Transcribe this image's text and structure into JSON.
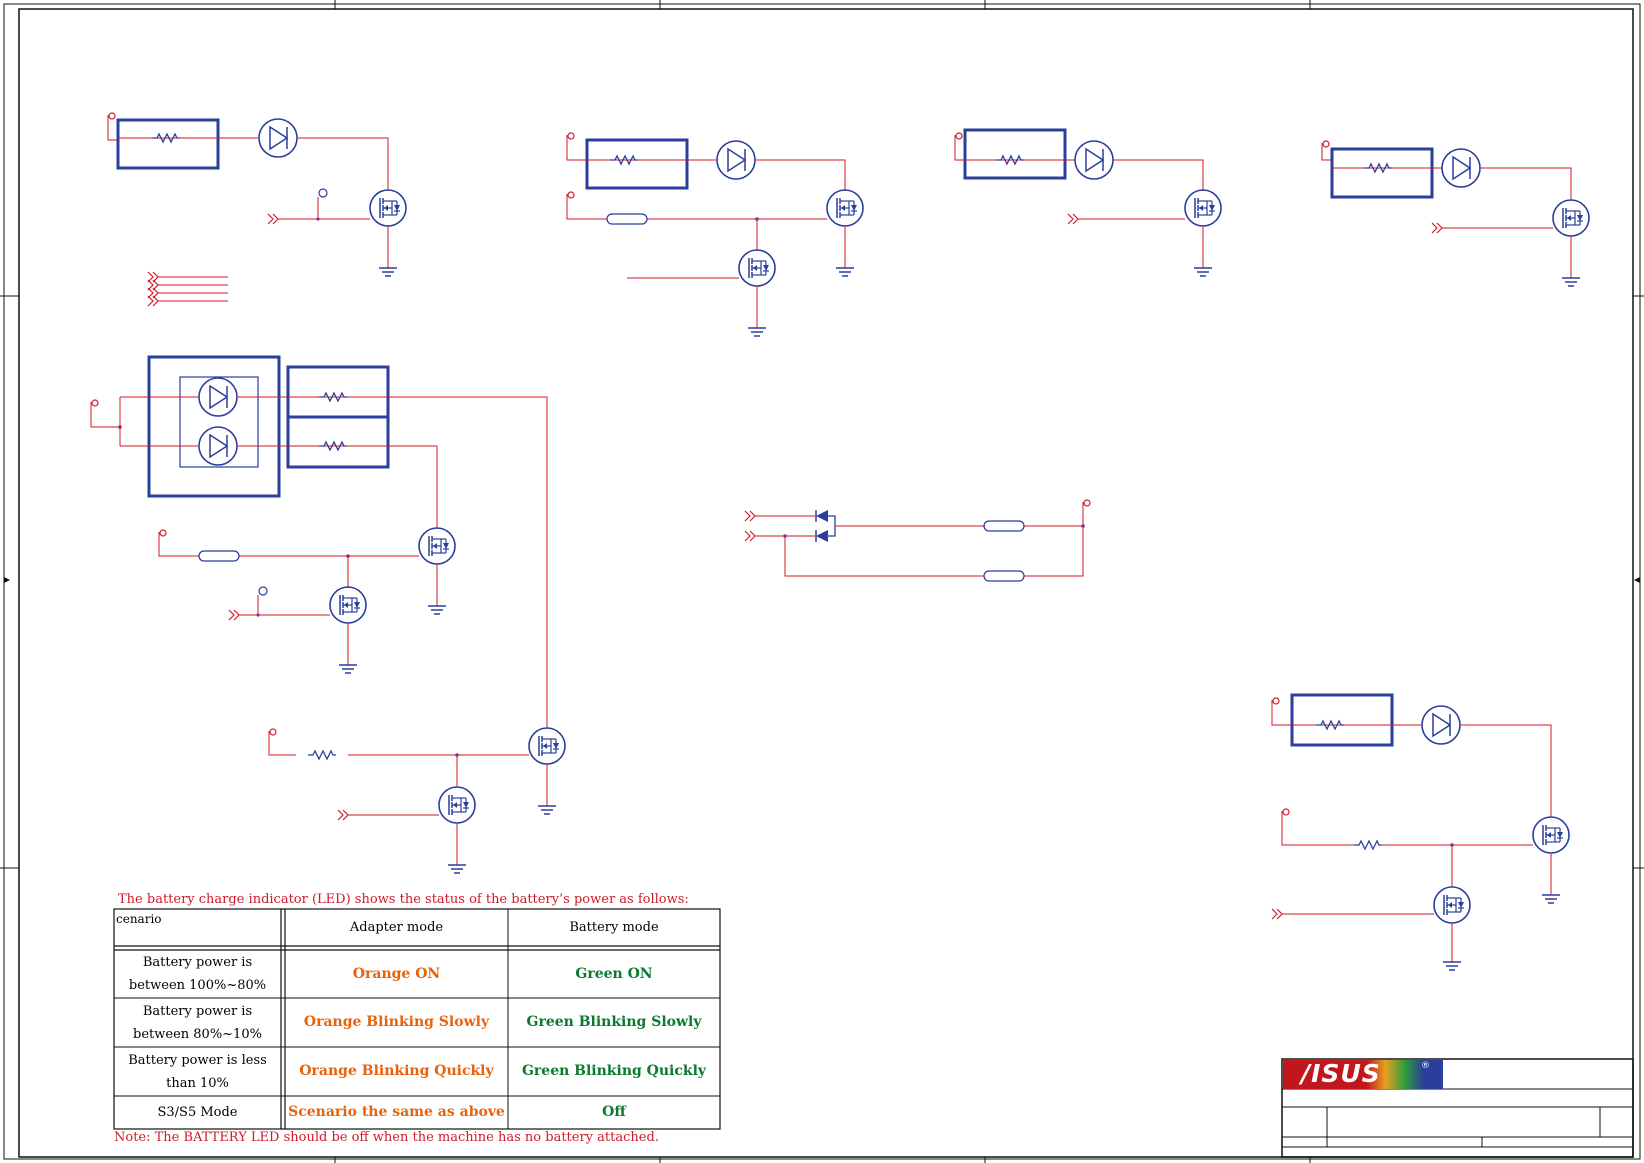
{
  "logo": {
    "text": "/ISUS",
    "registered": "®"
  },
  "table": {
    "caption": "The battery charge indicator (LED) shows the status of the battery’s power as follows:",
    "header": {
      "scenario": "cenario",
      "adapter": "Adapter mode",
      "battery": "Battery mode"
    },
    "rows": [
      {
        "scenario": "Battery power is between 100%~80%",
        "adapter": "Orange ON",
        "battery": "Green ON"
      },
      {
        "scenario": "Battery power is between 80%~10%",
        "adapter": "Orange Blinking Slowly",
        "battery": "Green Blinking Slowly"
      },
      {
        "scenario": "Battery power is less than 10%",
        "adapter": "Orange Blinking Quickly",
        "battery": "Green Blinking Quickly"
      },
      {
        "scenario": "S3/S5 Mode",
        "adapter": "Scenario the same as above",
        "battery": "Off"
      }
    ],
    "note": "Note: The BATTERY LED should be off when the machine has no battery attached."
  },
  "colors": {
    "wire": "#d11a2a",
    "component": "#2a3f9b",
    "frame": "#111111",
    "adapter_text": "#e8620a",
    "battery_text": "#0a7a2e"
  }
}
